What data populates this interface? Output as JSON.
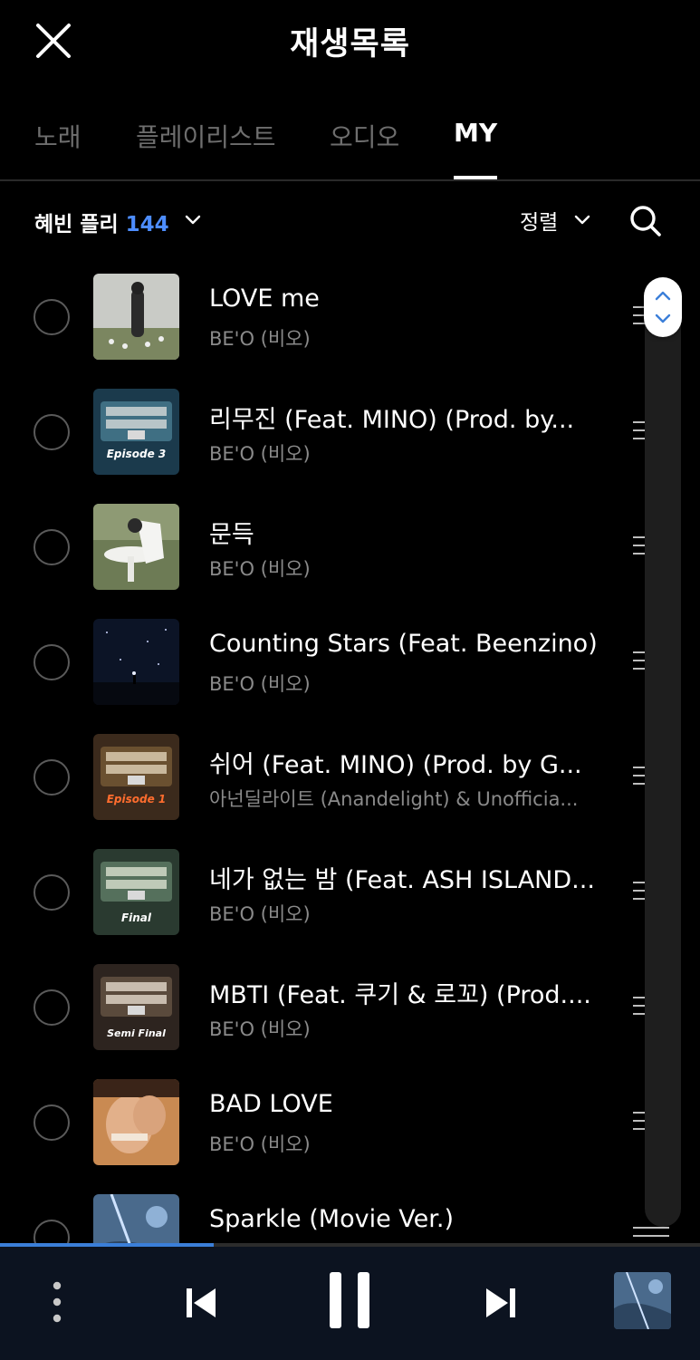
{
  "header": {
    "title": "재생목록"
  },
  "tabs": [
    {
      "label": "노래"
    },
    {
      "label": "플레이리스트"
    },
    {
      "label": "오디오"
    },
    {
      "label": "MY"
    }
  ],
  "active_tab": "MY",
  "playlist": {
    "name": "혜빈 플리",
    "count": "144",
    "sort_label": "정렬"
  },
  "songs": [
    {
      "title": "LOVE me",
      "artist": "BE'O (비오)",
      "cover_label": ""
    },
    {
      "title": "리무진 (Feat. MINO) (Prod. by...",
      "artist": "BE'O (비오)",
      "cover_label": "Episode 3"
    },
    {
      "title": "문득",
      "artist": "BE'O (비오)",
      "cover_label": ""
    },
    {
      "title": "Counting Stars (Feat. Beenzino)",
      "artist": "BE'O (비오)",
      "cover_label": ""
    },
    {
      "title": "쉬어 (Feat. MINO) (Prod. by G...",
      "artist": "아넌딜라이트 (Anandelight) & Unofficia...",
      "cover_label": "Episode 1"
    },
    {
      "title": "네가 없는 밤 (Feat. ASH ISLAND...",
      "artist": "BE'O (비오)",
      "cover_label": "Final"
    },
    {
      "title": "MBTI (Feat. 쿠기 & 로꼬) (Prod....",
      "artist": "BE'O (비오)",
      "cover_label": "Semi Final"
    },
    {
      "title": "BAD LOVE",
      "artist": "BE'O (비오)",
      "cover_label": ""
    },
    {
      "title": "Sparkle (Movie Ver.)",
      "artist": "",
      "cover_label": ""
    }
  ],
  "player": {
    "progress": 0.305
  },
  "colors": {
    "accent": "#4d8dff",
    "progress": "#3b7fd9",
    "background": "#000000",
    "player_bg": "#0c1320"
  },
  "icons": {
    "close": "close-icon",
    "chevron": "chevron-down-icon",
    "search": "search-icon",
    "drag": "drag-handle-icon",
    "more": "more-vertical-icon",
    "prev": "skip-previous-icon",
    "pause": "pause-icon",
    "next": "skip-next-icon"
  }
}
